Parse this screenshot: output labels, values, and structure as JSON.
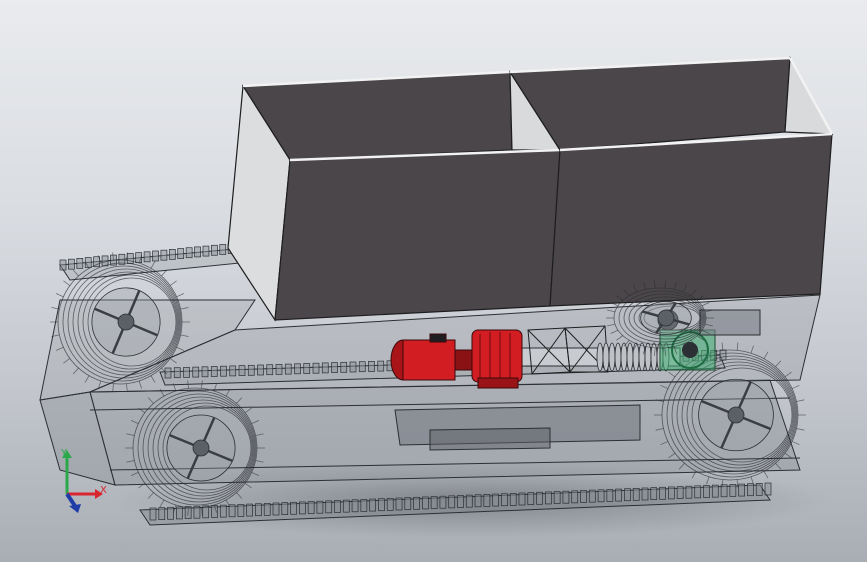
{
  "viewport": {
    "background_top": "#e9ebee",
    "background_bottom": "#a9adb4"
  },
  "model": {
    "hopper_color": "#4a4649",
    "hopper_inner_wall_color": "#d9dadb",
    "motor_color": "#d21d22",
    "gear_color": "#3fae72",
    "wireframe_color": "#2c2f33"
  },
  "triad": {
    "x_label": "X",
    "y_label": "Y",
    "x_color": "#d9262e",
    "y_color": "#2ba84a",
    "z_color": "#1f3ca8"
  }
}
